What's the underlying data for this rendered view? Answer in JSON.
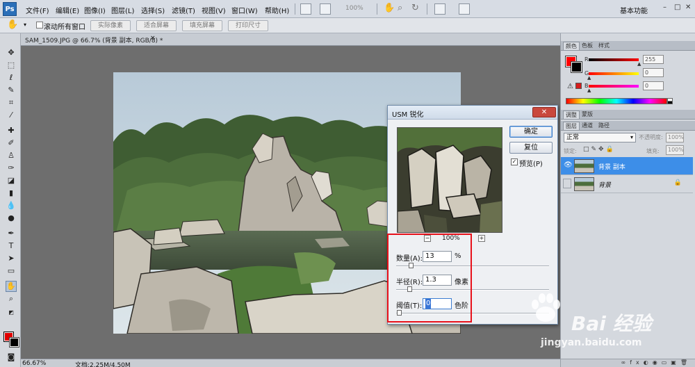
{
  "app": {
    "logo": "Ps",
    "menus": [
      "文件(F)",
      "编辑(E)",
      "图像(I)",
      "图层(L)",
      "选择(S)",
      "滤镜(T)",
      "视图(V)",
      "窗口(W)",
      "帮助(H)"
    ],
    "zoom_level": "100%",
    "workspace_label": "基本功能",
    "window_controls": [
      "–",
      "□",
      "✕"
    ]
  },
  "options_bar": {
    "scroll_all_label": "滚动所有窗口",
    "buttons": [
      "实际像素",
      "适合屏幕",
      "填充屏幕",
      "打印尺寸"
    ]
  },
  "document": {
    "tab_title": "SAM_1509.JPG @ 66.7% (背景 副本, RGB/8) *",
    "status_zoom": "66.67%",
    "status_doc": "文档:2.25M/4.50M"
  },
  "dialog": {
    "title": "USM 锐化",
    "close": "✕",
    "ok_label": "确定",
    "reset_label": "复位",
    "preview_label": "预览(P)",
    "preview_checked": true,
    "zoom_text": "100%",
    "zoom_out": "−",
    "zoom_in": "+",
    "fields": [
      {
        "label": "数量(A):",
        "value": "13",
        "unit": "%"
      },
      {
        "label": "半径(R):",
        "value": "1.3",
        "unit": "像素"
      },
      {
        "label": "阈值(T):",
        "value": "0",
        "unit": "色阶"
      }
    ]
  },
  "color_panel": {
    "tabs": [
      "颜色",
      "色板",
      "样式"
    ],
    "channels": [
      {
        "label": "R",
        "value": "255"
      },
      {
        "label": "G",
        "value": "0"
      },
      {
        "label": "B",
        "value": "0"
      }
    ],
    "foreground_color": "#ff0000",
    "background_color": "#000000"
  },
  "adjust_panel": {
    "tabs": [
      "调整",
      "蒙版"
    ]
  },
  "layers_panel": {
    "tabs": [
      "图层",
      "通道",
      "路径"
    ],
    "blend_mode": "正常",
    "opacity_label": "不透明度:",
    "opacity_value": "100%",
    "lock_label": "锁定:",
    "fill_label": "填充:",
    "fill_value": "100%",
    "layers": [
      {
        "name": "背景 副本",
        "selected": true,
        "visible": true
      },
      {
        "name": "背景",
        "selected": false,
        "visible": false
      }
    ]
  },
  "watermark": {
    "brand": "Bai 经验",
    "url": "jingyan.baidu.com"
  },
  "tools": [
    "move-tool",
    "marquee-tool",
    "lasso-tool",
    "quick-selection-tool",
    "crop-tool",
    "eyedropper-tool",
    "healing-brush-tool",
    "brush-tool",
    "clone-stamp-tool",
    "history-brush-tool",
    "eraser-tool",
    "gradient-tool",
    "blur-tool",
    "dodge-tool",
    "pen-tool",
    "type-tool",
    "path-selection-tool",
    "shape-tool",
    "hand-tool",
    "zoom-tool"
  ]
}
